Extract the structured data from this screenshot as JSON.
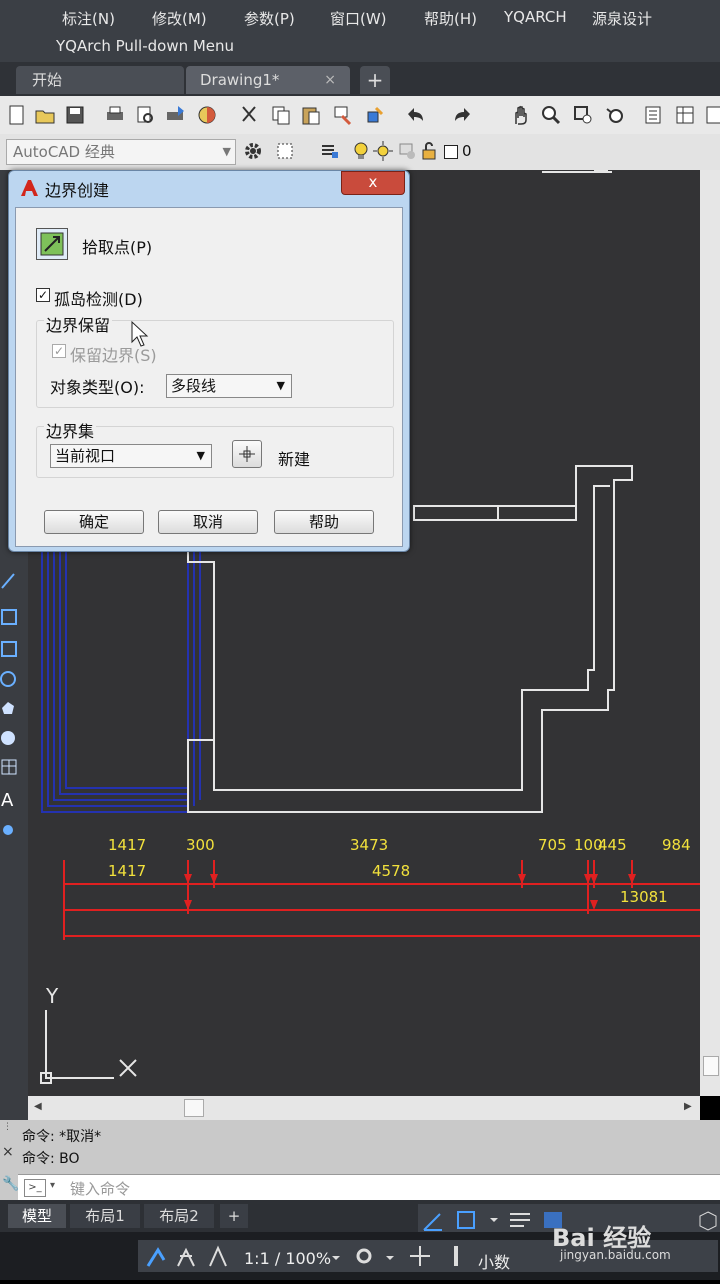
{
  "menu": {
    "items": [
      "标注(N)",
      "修改(M)",
      "参数(P)",
      "窗口(W)",
      "帮助(H)",
      "YQARCH",
      "源泉设计"
    ],
    "subtitle": "YQArch Pull-down Menu"
  },
  "tabs": {
    "start": "开始",
    "drawing": "Drawing1*",
    "close": "×",
    "new": "+"
  },
  "toolbar": {
    "workspace": "AutoCAD 经典",
    "layer_value": "0"
  },
  "dialog": {
    "title": "边界创建",
    "close": "x",
    "pick_points": "拾取点(P)",
    "island_detection": "孤岛检测(D)",
    "island_checked": "✓",
    "retain_group": "边界保留",
    "retain_boundary": "保留边界(S)",
    "retain_checked": "✓",
    "object_type_label": "对象类型(O):",
    "object_type_value": "多段线",
    "boundary_set_group": "边界集",
    "boundary_set_value": "当前视口",
    "new_label": "新建",
    "ok": "确定",
    "cancel": "取消",
    "help": "帮助"
  },
  "dimensions": {
    "row1": [
      "1417",
      "300",
      "3473",
      "705",
      "100",
      "445",
      "984"
    ],
    "row2": [
      "1417",
      "4578"
    ],
    "row3": [
      "13081"
    ]
  },
  "ucs": {
    "y": "Y",
    "x": "X"
  },
  "command": {
    "history": [
      "命令: *取消*",
      "命令: BO"
    ],
    "placeholder": "键入命令"
  },
  "layout_tabs": [
    "模型",
    "布局1",
    "布局2",
    "+"
  ],
  "status": {
    "zoom": "1:1 / 100%",
    "units": "小数"
  },
  "watermark": {
    "brand": "Bai 经验",
    "url": "jingyan.baidu.com"
  },
  "colors": {
    "canvas": "#333335",
    "dimension": "#e02020",
    "dimension_text": "#f2e13c",
    "hatch": "#2432b0",
    "walls": "#e6e6e6"
  }
}
